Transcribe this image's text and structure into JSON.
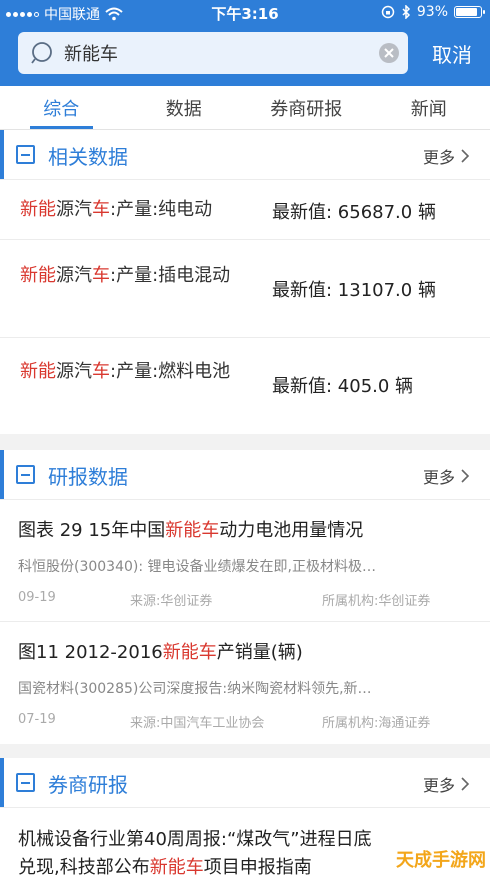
{
  "status": {
    "carrier": "中国联通",
    "time": "下午3:16",
    "battery": "93%",
    "battery_level": 0.93
  },
  "search": {
    "query": "新能车",
    "cancel_label": "取消"
  },
  "tabs": [
    "综合",
    "数据",
    "券商研报",
    "新闻"
  ],
  "related_data": {
    "title": "相关数据",
    "more": "更多",
    "rows": [
      {
        "hl1": "新能",
        "mid": "源汽",
        "hl2": "车",
        "rest": ":产量:纯电动",
        "value": "最新值:  65687.0 辆"
      },
      {
        "hl1": "新能",
        "mid": "源汽",
        "hl2": "车",
        "rest": ":产量:插电混动",
        "value": "最新值:  13107.0 辆"
      },
      {
        "hl1": "新能",
        "mid": "源汽",
        "hl2": "车",
        "rest": ":产量:燃料电池",
        "value": "最新值:  405.0 辆"
      }
    ]
  },
  "research_data": {
    "title": "研报数据",
    "more": "更多",
    "items": [
      {
        "pre": "图表 29 15年中国",
        "hl": "新能车",
        "post": "动力电池用量情况",
        "desc": "科恒股份(300340): 锂电设备业绩爆发在即,正极材料极…",
        "date": "09-19",
        "source": "来源:华创证券",
        "org": "所属机构:华创证券"
      },
      {
        "pre": "图11 2012-2016",
        "hl": "新能车",
        "post": "产销量(辆)",
        "desc": "国瓷材料(300285)公司深度报告:纳米陶瓷材料领先,新…",
        "date": "07-19",
        "source": "来源:中国汽车工业协会",
        "org": "所属机构:海通证券"
      }
    ]
  },
  "broker_research": {
    "title": "券商研报",
    "more": "更多",
    "item": {
      "line1": "机械设备行业第40周周报:“煤改气”进程日底",
      "pre2": "兑现,科技部公布",
      "hl": "新能车",
      "post2": "项目申报指南"
    }
  },
  "watermark": "天成手游网"
}
